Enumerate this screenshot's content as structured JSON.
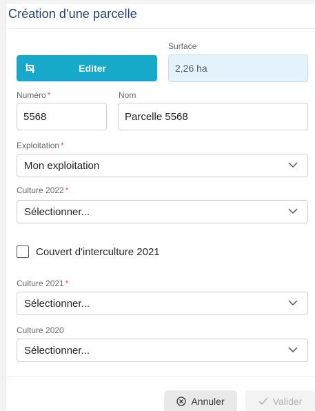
{
  "dialog": {
    "title": "Création d'une parcelle"
  },
  "edit": {
    "button_label": "Editer"
  },
  "surface": {
    "label": "Surface",
    "value": "2,26 ha"
  },
  "numero": {
    "label": "Numéro",
    "value": "5568"
  },
  "nom": {
    "label": "Nom",
    "value": "Parcelle 5568"
  },
  "exploitation": {
    "label": "Exploitation",
    "selected": "Mon exploitation"
  },
  "culture_2022": {
    "label": "Culture 2022",
    "selected": "Sélectionner..."
  },
  "couvert": {
    "label": "Couvert d'interculture 2021",
    "checked": false
  },
  "culture_2021": {
    "label": "Culture 2021",
    "selected": "Sélectionner..."
  },
  "culture_2020": {
    "label": "Culture 2020",
    "selected": "Sélectionner..."
  },
  "required_marker": "*",
  "footer": {
    "cancel_label": "Annuler",
    "validate_label": "Valider"
  },
  "colors": {
    "accent": "#16a9c9",
    "title": "#21426b",
    "required": "#e05a4f",
    "surface_bg": "#e4f3fb"
  },
  "icons": {
    "edit": "crop-edit-icon",
    "dropdown": "chevron-down-icon",
    "cancel": "circle-x-icon",
    "validate": "check-icon"
  }
}
